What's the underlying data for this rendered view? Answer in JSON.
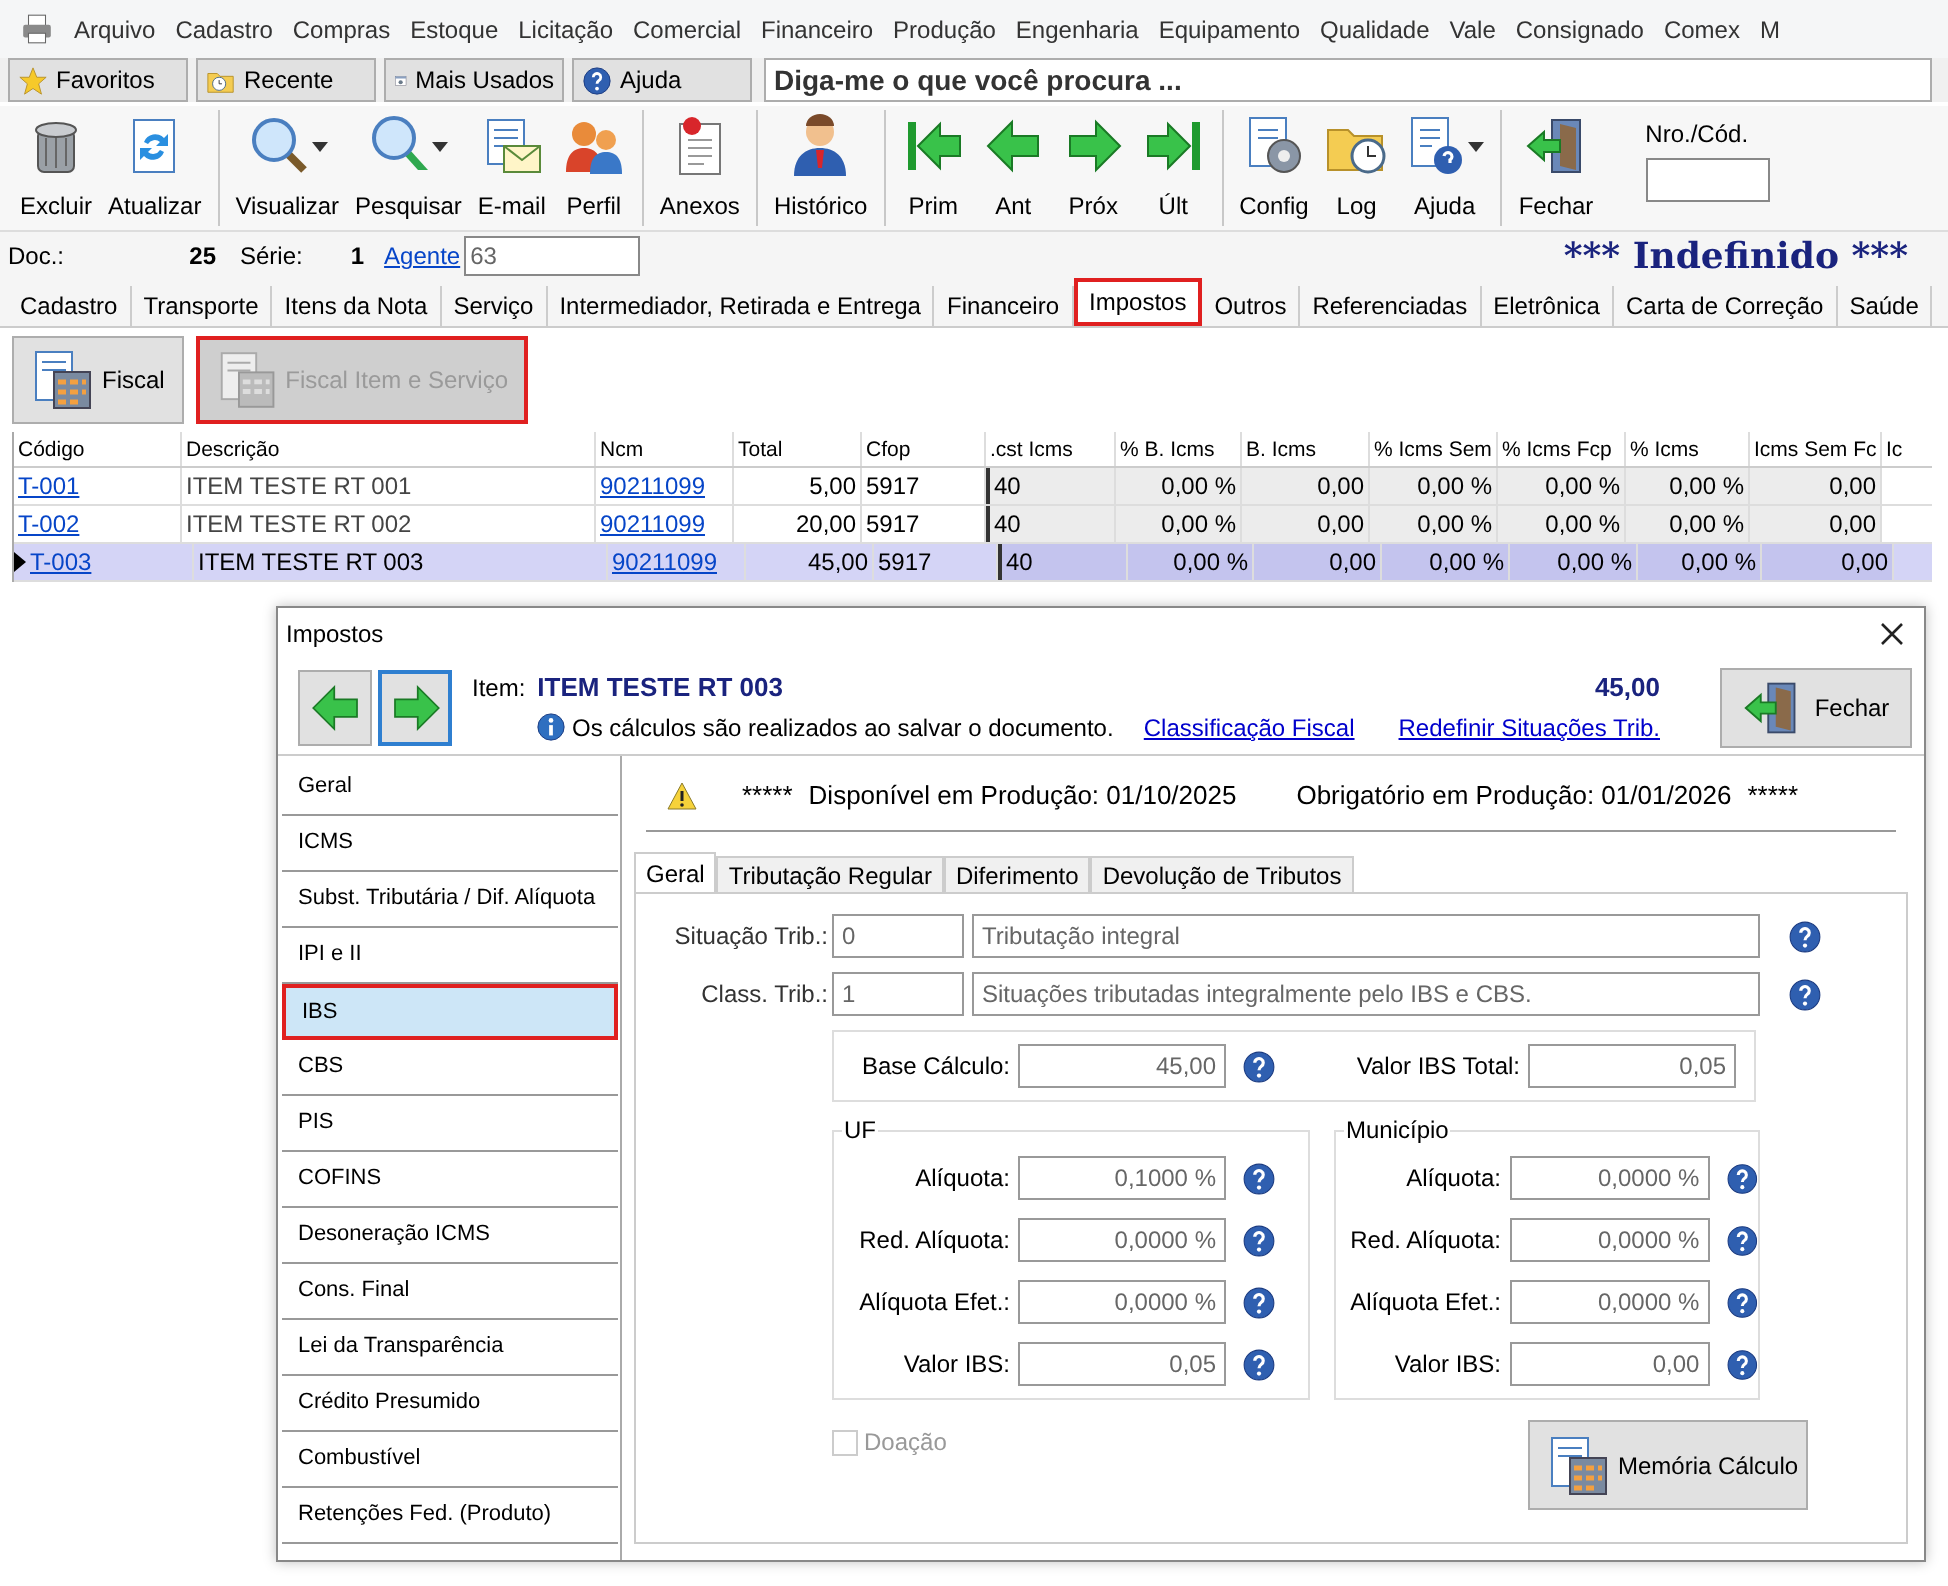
{
  "menu": [
    "Arquivo",
    "Cadastro",
    "Compras",
    "Estoque",
    "Licitação",
    "Comercial",
    "Financeiro",
    "Produção",
    "Engenharia",
    "Equipamento",
    "Qualidade",
    "Vale",
    "Consignado",
    "Comex",
    "M"
  ],
  "quick_bar": {
    "buttons": [
      "Favoritos",
      "Recente",
      "Mais Usados",
      "Ajuda"
    ],
    "search": {
      "placeholder": "Diga-me o que você procura ..."
    }
  },
  "toolbar": {
    "groups": [
      [
        {
          "label": "Excluir",
          "dropdown": false
        },
        {
          "label": "Atualizar",
          "dropdown": false
        }
      ],
      [
        {
          "label": "Visualizar",
          "dropdown": true
        },
        {
          "label": "Pesquisar",
          "dropdown": true
        },
        {
          "label": "E-mail",
          "dropdown": false
        },
        {
          "label": "Perfil",
          "dropdown": false
        }
      ],
      [
        {
          "label": "Anexos",
          "dropdown": false
        }
      ],
      [
        {
          "label": "Histórico",
          "dropdown": false
        }
      ],
      [
        {
          "label": "Prim",
          "dropdown": false
        },
        {
          "label": "Ant",
          "dropdown": false
        },
        {
          "label": "Próx",
          "dropdown": false
        },
        {
          "label": "Últ",
          "dropdown": false
        }
      ],
      [
        {
          "label": "Config",
          "dropdown": false
        },
        {
          "label": "Log",
          "dropdown": false
        },
        {
          "label": "Ajuda",
          "dropdown": true
        }
      ],
      [
        {
          "label": "Fechar",
          "dropdown": false
        }
      ]
    ],
    "code_field": {
      "label": "Nro./Cód."
    }
  },
  "doc_bar": {
    "doc_label": "Doc.:",
    "doc_number": "25",
    "serie_label": "Série:",
    "serie": "1",
    "agent_link": "Agente",
    "agent_value": "63",
    "status": "*** Indefinido ***"
  },
  "tabs": [
    {
      "label": "Cadastro",
      "selected": false,
      "highlighted": false
    },
    {
      "label": "Transporte",
      "selected": false,
      "highlighted": false
    },
    {
      "label": "Itens da Nota",
      "selected": false,
      "highlighted": false
    },
    {
      "label": "Serviço",
      "selected": false,
      "highlighted": false
    },
    {
      "label": "Intermediador, Retirada e Entrega",
      "selected": false,
      "highlighted": false
    },
    {
      "label": "Financeiro",
      "selected": false,
      "highlighted": false
    },
    {
      "label": "Impostos",
      "selected": true,
      "highlighted": true
    },
    {
      "label": "Outros",
      "selected": false,
      "highlighted": false
    },
    {
      "label": "Referenciadas",
      "selected": false,
      "highlighted": false
    },
    {
      "label": "Eletrônica",
      "selected": false,
      "highlighted": false
    },
    {
      "label": "Carta de Correção",
      "selected": false,
      "highlighted": false
    },
    {
      "label": "Saúde",
      "selected": false,
      "highlighted": false
    }
  ],
  "tax_buttons": [
    {
      "label": "Fiscal",
      "disabled": false,
      "highlighted": false
    },
    {
      "label": "Fiscal Item e Serviço",
      "disabled": true,
      "highlighted": true
    }
  ],
  "table": {
    "columns": [
      "Código",
      "Descrição",
      "Ncm",
      "Total",
      "Cfop",
      ".cst Icms",
      "% B. Icms",
      "B. Icms",
      "% Icms Sem",
      "% Icms Fcp",
      "% Icms",
      "Icms Sem Fc",
      "Ic"
    ],
    "rows": [
      {
        "selected": false,
        "cells": [
          "T-001",
          "ITEM TESTE RT 001",
          "90211099",
          "5,00",
          "5917",
          "40",
          "0,00 %",
          "0,00",
          "0,00 %",
          "0,00 %",
          "0,00 %",
          "0,00"
        ]
      },
      {
        "selected": false,
        "cells": [
          "T-002",
          "ITEM TESTE RT 002",
          "90211099",
          "20,00",
          "5917",
          "40",
          "0,00 %",
          "0,00",
          "0,00 %",
          "0,00 %",
          "0,00 %",
          "0,00"
        ]
      },
      {
        "selected": true,
        "cells": [
          "T-003",
          "ITEM TESTE RT 003",
          "90211099",
          "45,00",
          "5917",
          "40",
          "0,00 %",
          "0,00",
          "0,00 %",
          "0,00 %",
          "0,00 %",
          "0,00"
        ]
      }
    ]
  },
  "dialog": {
    "title": "Impostos",
    "item_label": "Item:",
    "item_name": "ITEM TESTE RT 003",
    "total": "45,00",
    "info": "Os cálculos são realizados ao salvar o documento.",
    "links": [
      "Classificação Fiscal",
      "Redefinir Situações Trib."
    ],
    "close_button": "Fechar",
    "sidebar": [
      {
        "label": "Geral",
        "selected": false,
        "highlighted": false
      },
      {
        "label": "ICMS",
        "selected": false,
        "highlighted": false
      },
      {
        "label": "Subst. Tributária / Dif. Alíquota",
        "selected": false,
        "highlighted": false
      },
      {
        "label": "IPI e II",
        "selected": false,
        "highlighted": false
      },
      {
        "label": "IBS",
        "selected": true,
        "highlighted": true
      },
      {
        "label": "CBS",
        "selected": false,
        "highlighted": false
      },
      {
        "label": "PIS",
        "selected": false,
        "highlighted": false
      },
      {
        "label": "COFINS",
        "selected": false,
        "highlighted": false
      },
      {
        "label": "Desoneração ICMS",
        "selected": false,
        "highlighted": false
      },
      {
        "label": "Cons. Final",
        "selected": false,
        "highlighted": false
      },
      {
        "label": "Lei da Transparência",
        "selected": false,
        "highlighted": false
      },
      {
        "label": "Crédito Presumido",
        "selected": false,
        "highlighted": false
      },
      {
        "label": "Combustível",
        "selected": false,
        "highlighted": false
      },
      {
        "label": "Retenções Fed. (Produto)",
        "selected": false,
        "highlighted": false
      }
    ],
    "notice": {
      "stars_left": "*****",
      "available": "Disponível em Produção: 01/10/2025",
      "mandatory": "Obrigatório em Produção: 01/01/2026",
      "stars_right": "*****"
    },
    "inner_tabs": [
      {
        "label": "Geral",
        "selected": true
      },
      {
        "label": "Tributação Regular",
        "selected": false
      },
      {
        "label": "Diferimento",
        "selected": false
      },
      {
        "label": "Devolução de Tributos",
        "selected": false
      }
    ],
    "code_rows": [
      {
        "label": "Situação Trib.:",
        "code": "0",
        "description": "Tributação integral"
      },
      {
        "label": "Class. Trib.:",
        "code": "1",
        "description": "Situações tributadas integralmente pelo IBS e CBS."
      }
    ],
    "totals": [
      {
        "label": "Base Cálculo:",
        "value": "45,00"
      },
      {
        "label": "Valor IBS Total:",
        "value": "0,05"
      }
    ],
    "groups": [
      {
        "title": "UF",
        "rows": [
          {
            "label": "Alíquota:",
            "value": "0,1000 %"
          },
          {
            "label": "Red. Alíquota:",
            "value": "0,0000 %"
          },
          {
            "label": "Alíquota Efet.:",
            "value": "0,0000 %"
          },
          {
            "label": "Valor IBS:",
            "value": "0,05"
          }
        ]
      },
      {
        "title": "Município",
        "rows": [
          {
            "label": "Alíquota:",
            "value": "0,0000 %"
          },
          {
            "label": "Red. Alíquota:",
            "value": "0,0000 %"
          },
          {
            "label": "Alíquota Efet.:",
            "value": "0,0000 %"
          },
          {
            "label": "Valor IBS:",
            "value": "0,00"
          }
        ]
      }
    ],
    "donation": {
      "label": "Doação",
      "checked": false,
      "disabled": true
    },
    "memory_button": "Memória Cálculo"
  }
}
